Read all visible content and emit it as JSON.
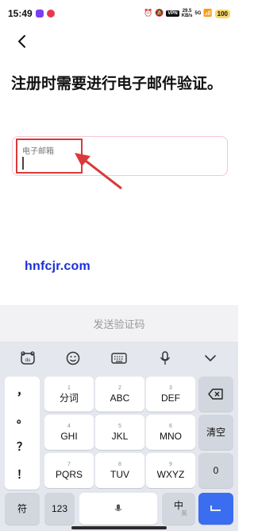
{
  "status_bar": {
    "time": "15:49",
    "speed_value": "29.5",
    "speed_unit": "KB/s",
    "vpn": "VPN",
    "network": "5G",
    "battery": "100",
    "app_colors": [
      "#7a3ff2",
      "#e8384f"
    ]
  },
  "header": {
    "back_icon": "chevron-left-icon"
  },
  "main": {
    "title": "注册时需要进行电子邮件验证。",
    "email_field": {
      "label": "电子邮箱",
      "value": "",
      "placeholder": ""
    },
    "border_color": "#f5c6d3"
  },
  "annotation": {
    "color": "#d83a3a"
  },
  "watermark": {
    "text": "hnfcjr.com",
    "color": "#1a2fd6"
  },
  "send_button": {
    "label": "发送验证码",
    "color": "#9a9a9f"
  },
  "keyboard": {
    "toolbar_icons": [
      "keyboard-emoji-face-icon",
      "emoji-icon",
      "keyboard-layout-icon",
      "microphone-icon",
      "chevron-down-icon"
    ],
    "punctuation": [
      "，",
      "。",
      "？",
      "！"
    ],
    "keys": {
      "k1": {
        "num": "1",
        "label": "分词"
      },
      "k2": {
        "num": "2",
        "label": "ABC"
      },
      "k3": {
        "num": "3",
        "label": "DEF"
      },
      "k4": {
        "num": "4",
        "label": "GHI"
      },
      "k5": {
        "num": "5",
        "label": "JKL"
      },
      "k6": {
        "num": "6",
        "label": "MNO"
      },
      "k7": {
        "num": "7",
        "label": "PQRS"
      },
      "k8": {
        "num": "8",
        "label": "TUV"
      },
      "k9": {
        "num": "9",
        "label": "WXYZ"
      }
    },
    "clear": "清空",
    "zero": "0",
    "symbols": "符",
    "numbers": "123",
    "lang_main": "中",
    "lang_sub": "英",
    "enter_color": "#3a6df0"
  }
}
